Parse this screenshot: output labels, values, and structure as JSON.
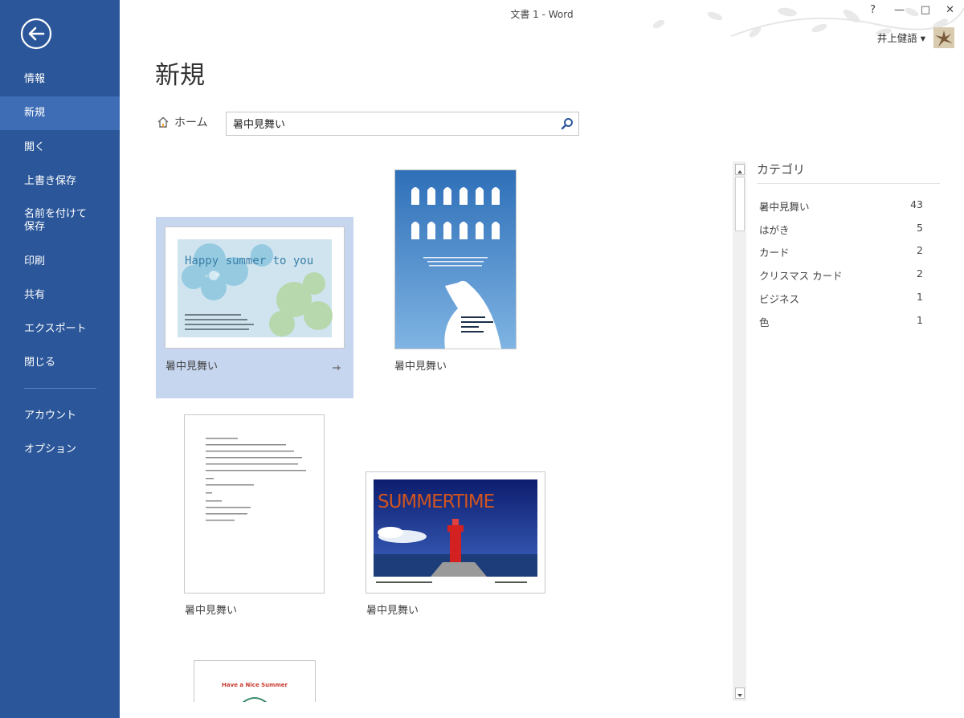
{
  "window": {
    "title": "文書 1 - Word",
    "help": "?",
    "minimize": "—",
    "maximize": "□",
    "close": "✕"
  },
  "user": {
    "name": "井上健語 ▾"
  },
  "sidebar": {
    "items": [
      {
        "label": "情報"
      },
      {
        "label": "新規"
      },
      {
        "label": "開く"
      },
      {
        "label": "上書き保存"
      },
      {
        "label": "名前を付けて\n保存"
      },
      {
        "label": "印刷"
      },
      {
        "label": "共有"
      },
      {
        "label": "エクスポート"
      },
      {
        "label": "閉じる"
      },
      {
        "label": "アカウント"
      },
      {
        "label": "オプション"
      }
    ]
  },
  "main": {
    "page_title": "新規",
    "home_label": "ホーム",
    "search": {
      "value": "暑中見舞い"
    }
  },
  "templates": [
    {
      "label": "暑中見舞い",
      "text": "Happy summer to you"
    },
    {
      "label": "暑中見舞い"
    },
    {
      "label": "暑中見舞い"
    },
    {
      "label": "暑中見舞い",
      "text": "SUMMERTIME"
    },
    {
      "text": "Have a Nice Summer"
    }
  ],
  "categories": {
    "title": "カテゴリ",
    "items": [
      {
        "name": "暑中見舞い",
        "count": "43"
      },
      {
        "name": "はがき",
        "count": "5"
      },
      {
        "name": "カード",
        "count": "2"
      },
      {
        "name": "クリスマス カード",
        "count": "2"
      },
      {
        "name": "ビジネス",
        "count": "1"
      },
      {
        "name": "色",
        "count": "1"
      }
    ]
  },
  "colors": {
    "sidebar": "#2b579a",
    "selected_nav": "#3e6db5",
    "selected_tile": "#c7d6ef"
  }
}
